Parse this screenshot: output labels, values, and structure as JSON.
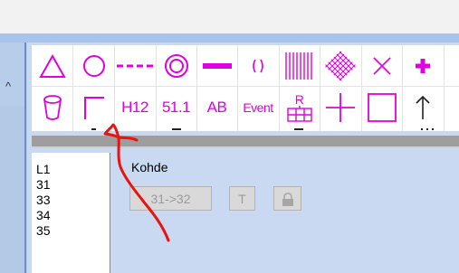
{
  "toolbar": {
    "row1": [
      {
        "name": "triangle-icon"
      },
      {
        "name": "circle-icon"
      },
      {
        "name": "dashed-line-icon"
      },
      {
        "name": "concentric-circle-icon"
      },
      {
        "name": "thick-line-icon"
      },
      {
        "name": "bracket-pair-icon"
      },
      {
        "name": "vertical-hatch-icon"
      },
      {
        "name": "crosshatch-icon"
      },
      {
        "name": "x-icon"
      },
      {
        "name": "plus-bold-icon"
      }
    ],
    "row2": {
      "h12": "H12",
      "n511": "51.1",
      "ab": "AB",
      "event": "Event",
      "r": "R"
    }
  },
  "object_list": [
    "L1",
    "31",
    "33",
    "34",
    "35"
  ],
  "panel": {
    "title": "Kohde",
    "range_button": "31->32",
    "t_button": "T"
  },
  "colors": {
    "magenta": "#e000e0",
    "annotation_red": "#e8140f",
    "panel_bg": "#c8d9f1"
  }
}
